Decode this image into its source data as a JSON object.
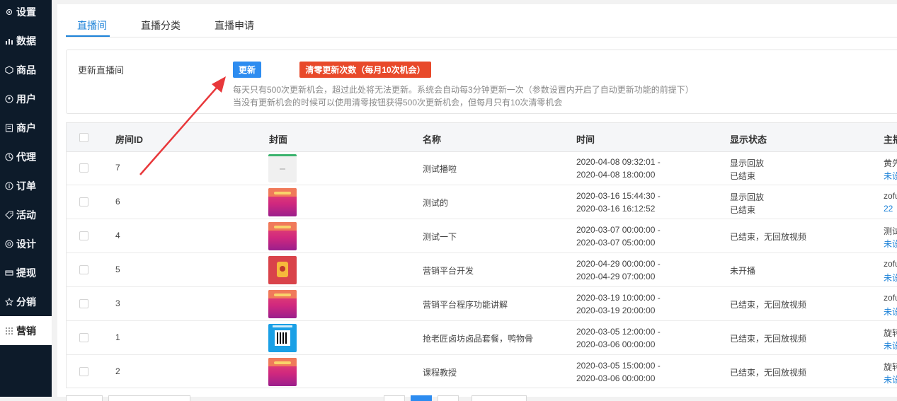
{
  "sidebar": {
    "items": [
      {
        "label": "设置",
        "icon": "gear-icon"
      },
      {
        "label": "数据",
        "icon": "bar-chart-icon"
      },
      {
        "label": "商品",
        "icon": "box-icon"
      },
      {
        "label": "用户",
        "icon": "user-icon"
      },
      {
        "label": "商户",
        "icon": "document-icon"
      },
      {
        "label": "代理",
        "icon": "pie-icon"
      },
      {
        "label": "订单",
        "icon": "info-circle-icon"
      },
      {
        "label": "活动",
        "icon": "tag-icon"
      },
      {
        "label": "设计",
        "icon": "palette-icon"
      },
      {
        "label": "提现",
        "icon": "card-icon"
      },
      {
        "label": "分销",
        "icon": "star-icon"
      },
      {
        "label": "营销",
        "icon": "grid-icon"
      }
    ],
    "active": "营销"
  },
  "tabs": [
    {
      "label": "直播间",
      "active": true
    },
    {
      "label": "直播分类",
      "active": false
    },
    {
      "label": "直播申请",
      "active": false
    }
  ],
  "update": {
    "label": "更新直播间",
    "update_button": "更新",
    "clear_button": "清零更新次数（每月10次机会）",
    "note1": "每天只有500次更新机会，超过此处将无法更新。系统会自动每3分钟更新一次（参数设置内开启了自动更新功能的前提下）",
    "note2": "当没有更新机会的时候可以使用清零按钮获得500次更新机会，但每月只有10次清零机会"
  },
  "table": {
    "headers": [
      "房间ID",
      "封面",
      "名称",
      "时间",
      "显示状态",
      "主播"
    ],
    "rows": [
      {
        "id": "7",
        "cover": "gray",
        "name": "测试播啦",
        "time1": "2020-04-08 09:32:01 -",
        "time2": "2020-04-08 18:00:00",
        "status1": "显示回放",
        "status2": "已结束",
        "anchor1": "黄先",
        "anchor2": "未设"
      },
      {
        "id": "6",
        "cover": "pink",
        "name": "测试的",
        "time1": "2020-03-16 15:44:30 -",
        "time2": "2020-03-16 16:12:52",
        "status1": "显示回放",
        "status2": "已结束",
        "anchor1": "zofu",
        "anchor2": "22"
      },
      {
        "id": "4",
        "cover": "pink",
        "name": "测试一下",
        "time1": "2020-03-07 00:00:00 -",
        "time2": "2020-03-07 05:00:00",
        "status1": "已结束，无回放视频",
        "status2": "",
        "anchor1": "测试",
        "anchor2": "未设"
      },
      {
        "id": "5",
        "cover": "red",
        "name": "营销平台开发",
        "time1": "2020-04-29 00:00:00 -",
        "time2": "2020-04-29 07:00:00",
        "status1": "未开播",
        "status2": "",
        "anchor1": "zofu",
        "anchor2": "未设"
      },
      {
        "id": "3",
        "cover": "pink",
        "name": "营销平台程序功能讲解",
        "time1": "2020-03-19 10:00:00 -",
        "time2": "2020-03-19 20:00:00",
        "status1": "已结束，无回放视频",
        "status2": "",
        "anchor1": "zofu",
        "anchor2": "未设"
      },
      {
        "id": "1",
        "cover": "qr",
        "name": "抢老匠卤坊卤品套餐，鸭物骨",
        "time1": "2020-03-05 12:00:00 -",
        "time2": "2020-03-06 00:00:00",
        "status1": "已结束，无回放视频",
        "status2": "",
        "anchor1": "旋转",
        "anchor2": "未设"
      },
      {
        "id": "2",
        "cover": "pink",
        "name": "课程教授",
        "time1": "2020-03-05 15:00:00 -",
        "time2": "2020-03-06 00:00:00",
        "status1": "已结束，无回放视频",
        "status2": "",
        "anchor1": "旋转",
        "anchor2": "未设"
      }
    ]
  },
  "colors": {
    "accent": "#1d82d8",
    "update_button": "#2d8cf0",
    "clear_button": "#e8492a",
    "arrow": "#e8383b",
    "sidebar": "#0d1b2a"
  }
}
